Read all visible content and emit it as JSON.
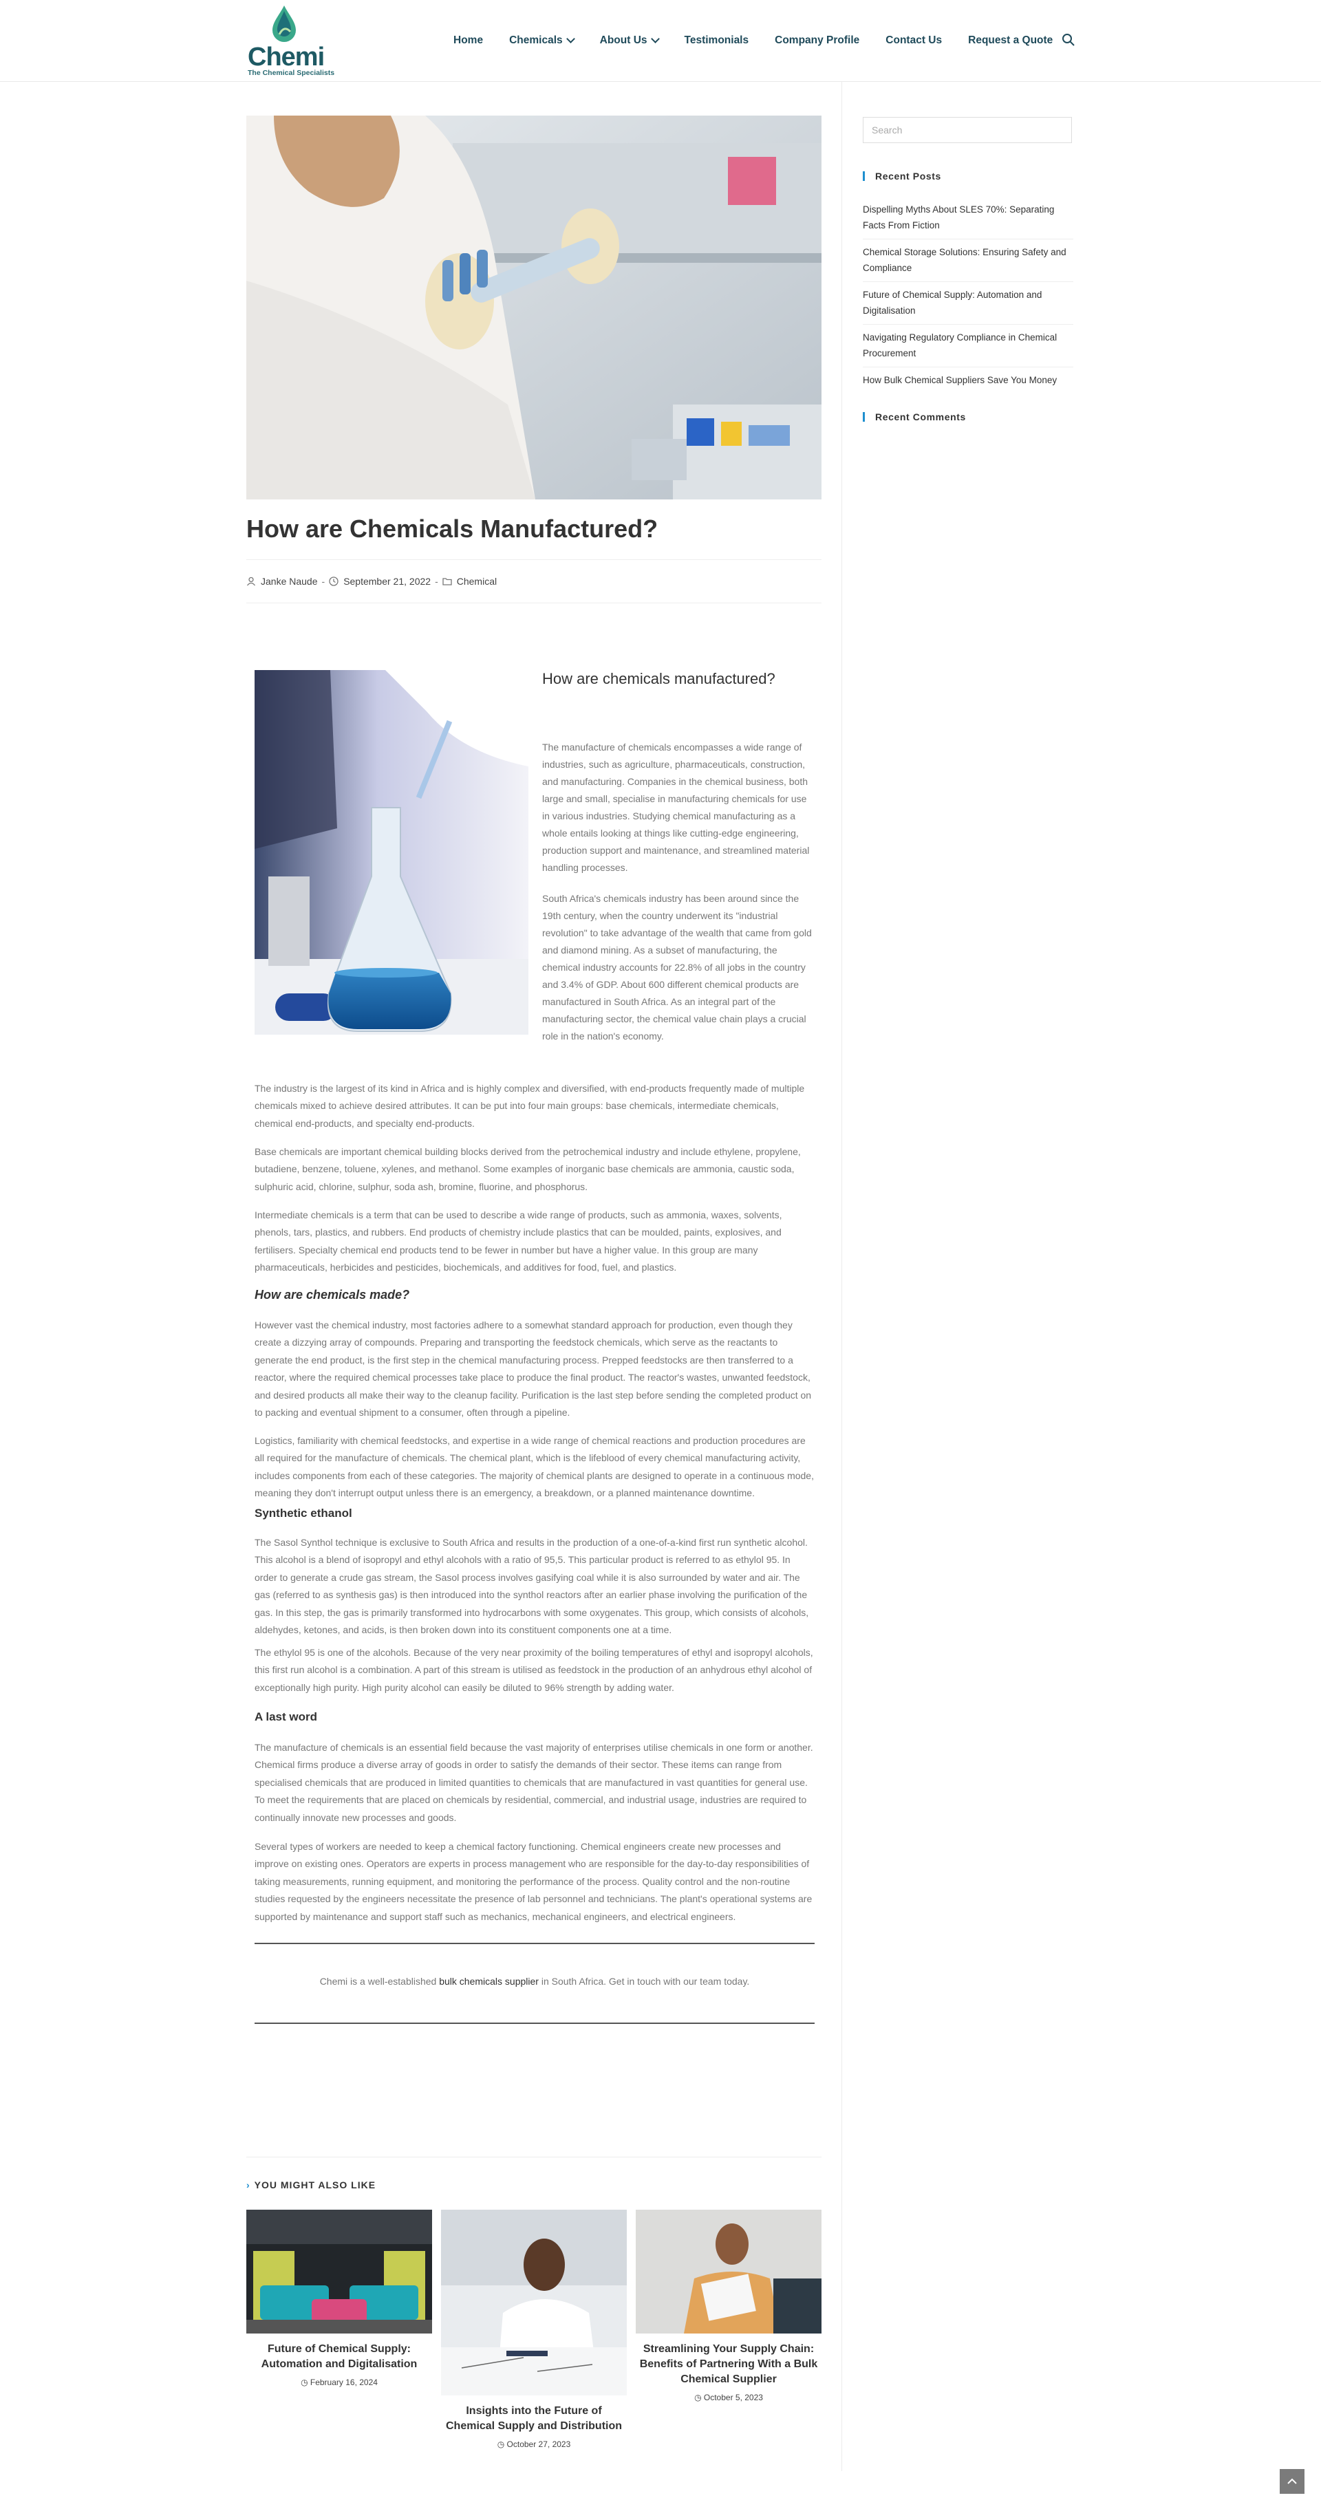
{
  "header": {
    "logo_word": "Chemi",
    "logo_tagline": "The Chemical Specialists",
    "nav": [
      {
        "label": "Home",
        "has_dropdown": false
      },
      {
        "label": "Chemicals",
        "has_dropdown": true
      },
      {
        "label": "About Us",
        "has_dropdown": true
      },
      {
        "label": "Testimonials",
        "has_dropdown": false
      },
      {
        "label": "Company Profile",
        "has_dropdown": false
      },
      {
        "label": "Contact Us",
        "has_dropdown": false
      },
      {
        "label": "Request a Quote",
        "has_dropdown": false
      }
    ],
    "search_icon": "search-icon"
  },
  "post": {
    "title": "How are Chemicals Manufactured?",
    "author": "Janke Naude",
    "date": "September 21, 2022",
    "category": "Chemical"
  },
  "article": {
    "side_heading": "How are chemicals manufactured?",
    "side_p1": "The manufacture of chemicals encompasses a wide range of industries, such as agriculture, pharmaceuticals, construction, and manufacturing. Companies in the chemical business, both large and small, specialise in manufacturing chemicals for use in various industries. Studying chemical manufacturing as a whole entails looking at things like cutting-edge engineering, production support and maintenance, and streamlined material handling processes.",
    "side_p2": "South Africa's chemicals industry has been around since the 19th century, when the country underwent its \"industrial revolution\" to take advantage of the wealth that came from gold and diamond mining. As a subset of manufacturing, the chemical industry accounts for 22.8% of all jobs in the country and 3.4% of GDP. About 600 different chemical products are manufactured in South Africa. As an integral part of the manufacturing sector, the chemical value chain plays a crucial role in the nation's economy.",
    "p1": "The industry is the largest of its kind in Africa and is highly complex and diversified, with end-products frequently made of multiple chemicals mixed to achieve desired attributes. It can be put into four main groups: base chemicals, intermediate chemicals, chemical end-products, and specialty end-products.",
    "p2": "Base chemicals are important chemical building blocks derived from the petrochemical industry and include ethylene, propylene, butadiene, benzene, toluene, xylenes, and methanol. Some examples of inorganic base chemicals are ammonia, caustic soda, sulphuric acid, chlorine, sulphur, soda ash, bromine, fluorine, and phosphorus.",
    "p3": "Intermediate chemicals is a term that can be used to describe a wide range of products, such as ammonia, waxes, solvents, phenols, tars, plastics, and rubbers. End products of chemistry include plastics that can be moulded, paints, explosives, and fertilisers. Specialty chemical end products tend to be fewer in number but have a higher value. In this group are many pharmaceuticals, herbicides and pesticides, biochemicals, and additives for food, fuel, and plastics.",
    "h_made": "How are chemicals made?",
    "p4": "However vast the chemical industry, most factories adhere to a somewhat standard approach for production, even though they create a dizzying array of compounds. Preparing and transporting the feedstock chemicals, which serve as the reactants to generate the end product, is the first step in the chemical manufacturing process. Prepped feedstocks are then transferred to a reactor, where the required chemical processes take place to produce the final product. The reactor's wastes, unwanted feedstock, and desired products all make their way to the cleanup facility. Purification is the last step before sending the completed product on to packing and eventual shipment to a consumer, often through a pipeline.",
    "p5": "Logistics, familiarity with chemical feedstocks, and expertise in a wide range of chemical reactions and production procedures are all required for the manufacture of chemicals. The chemical plant, which is the lifeblood of every chemical manufacturing activity, includes components from each of these categories. The majority of chemical plants are designed to operate in a continuous mode, meaning they don't interrupt output unless there is an emergency, a breakdown, or a planned maintenance downtime.",
    "h_ethanol": "Synthetic ethanol",
    "p6": "The Sasol Synthol technique is exclusive to South Africa and results in the production of a one-of-a-kind first run synthetic alcohol. This alcohol is a blend of isopropyl and ethyl alcohols with a ratio of 95,5. This particular product is referred to as ethylol 95. In order to generate a crude gas stream, the Sasol process involves gasifying coal while it is also surrounded by water and air. The gas (referred to as synthesis gas) is then introduced into the synthol reactors after an earlier phase involving the purification of the gas. In this step, the gas is primarily transformed into hydrocarbons with some oxygenates. This group, which consists of alcohols, aldehydes, ketones, and acids, is then broken down into its constituent components one at a time.",
    "p7": "The ethylol 95 is one of the alcohols. Because of the very near proximity of the boiling temperatures of ethyl and isopropyl alcohols, this first run alcohol is a combination. A part of this stream is utilised as feedstock in the production of an anhydrous ethyl alcohol of exceptionally high purity. High purity alcohol can easily be diluted to 96% strength by adding water.",
    "h_last": "A last word",
    "p8": "The manufacture of chemicals is an essential field because the vast majority of enterprises utilise chemicals in one form or another. Chemical firms produce a diverse array of goods in order to satisfy the demands of their sector. These items can range from specialised chemicals that are produced in limited quantities to chemicals that are manufactured in vast quantities for general use. To meet the requirements that are placed on chemicals by residential, commercial, and industrial usage, industries are required to continually innovate new processes and goods.",
    "p9": "Several types of workers are needed to keep a chemical factory functioning. Chemical engineers create new processes and improve on existing ones. Operators are experts in process management who are responsible for the day-to-day responsibilities of taking measurements, running equipment, and monitoring the performance of the process. Quality control and the non-routine studies requested by the engineers necessitate the presence of lab personnel and technicians. The plant's operational systems are supported by maintenance and support staff such as mechanics, mechanical engineers, and electrical engineers.",
    "cta_before": "Chemi is a well-established ",
    "cta_link": "bulk chemicals supplier",
    "cta_after": " in South Africa. Get in touch with our team today."
  },
  "related": {
    "title": "YOU MIGHT ALSO LIKE",
    "items": [
      {
        "title": "Future of Chemical Supply: Automation and Digitalisation",
        "date": "February 16, 2024"
      },
      {
        "title": "Insights into the Future of Chemical Supply and Distribution",
        "date": "October 27, 2023"
      },
      {
        "title": "Streamlining Your Supply Chain: Benefits of Partnering With a Bulk Chemical Supplier",
        "date": "October 5, 2023"
      }
    ]
  },
  "sidebar": {
    "search_placeholder": "Search",
    "recent_posts_title": "Recent Posts",
    "recent_posts": [
      "Dispelling Myths About SLES 70%: Separating Facts From Fiction",
      "Chemical Storage Solutions: Ensuring Safety and Compliance",
      "Future of Chemical Supply: Automation and Digitalisation",
      "Navigating Regulatory Compliance in Chemical Procurement",
      "How Bulk Chemical Suppliers Save You Money"
    ],
    "recent_comments_title": "Recent Comments"
  },
  "colors": {
    "accent": "#1e8fcf",
    "nav_text": "#1f4a5a",
    "logo": "#1e5a64"
  }
}
